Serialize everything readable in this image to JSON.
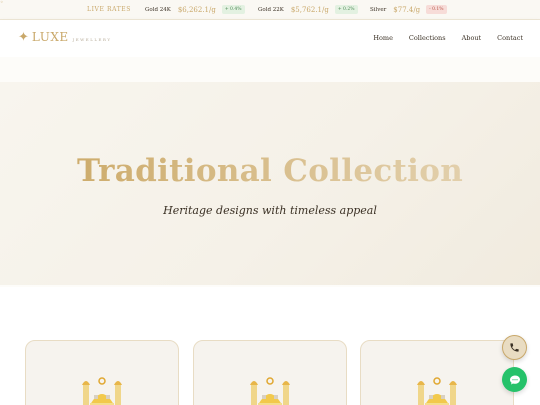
{
  "ticker": {
    "live_label": "LIVE RATES",
    "rates": [
      {
        "name": "Gold 24K",
        "price": "$6,262.1/g",
        "change": "+ 0.4%",
        "direction": "up"
      },
      {
        "name": "Gold 22K",
        "price": "$5,762.1/g",
        "change": "+ 0.2%",
        "direction": "up"
      },
      {
        "name": "Silver",
        "price": "$77.4/g",
        "change": "- 0.1%",
        "direction": "down"
      }
    ]
  },
  "brand": {
    "name": "LUXE",
    "tagline": "JEWELLERY"
  },
  "nav": {
    "items": [
      "Home",
      "Collections",
      "About",
      "Contact"
    ]
  },
  "hero": {
    "title": "Traditional Collection",
    "subtitle": "Heritage designs with timeless appeal"
  },
  "colors": {
    "gold": "#c9a86a",
    "cream": "#f5f1e8",
    "text": "#3a3024",
    "whatsapp": "#25c26a"
  },
  "icons": {
    "phone": "phone-icon",
    "chat": "chat-icon",
    "sparkle": "sparkle-icon",
    "product": "mosque-icon"
  }
}
